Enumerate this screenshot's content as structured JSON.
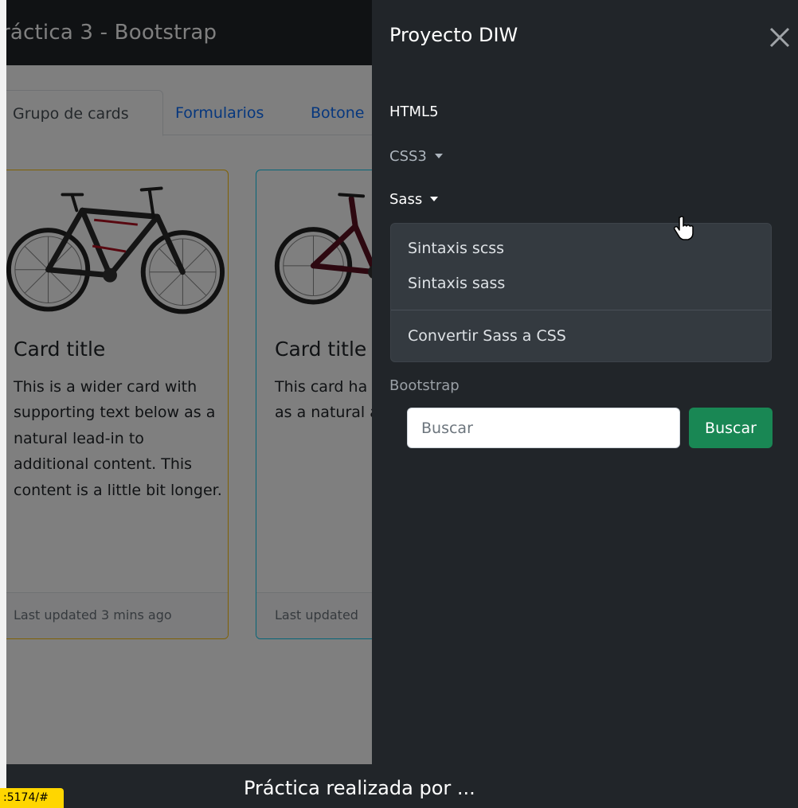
{
  "page": {
    "navbar_brand": "ráctica 3 - Bootstrap",
    "tabs": [
      {
        "label": "Grupo de cards",
        "active": true
      },
      {
        "label": "Formularios",
        "active": false
      },
      {
        "label": "Botone",
        "active": false
      }
    ],
    "cards": [
      {
        "title": "Card title",
        "text": "This is a wider card with supporting text below as a natural lead-in to additional content. This content is a little bit longer.",
        "footer": "Last updated 3 mins ago",
        "border_color": "#ffc107"
      },
      {
        "title": "Card title",
        "text": "This card ha supporting t as a natural additional c",
        "footer": "Last updated",
        "border_color": "#0dcaf0"
      }
    ],
    "footer_text": "Práctica realizada por ..."
  },
  "status_url": ":5174/#",
  "offcanvas": {
    "title": "Proyecto DIW",
    "close_icon": "close-icon",
    "nav": {
      "html5": "HTML5",
      "css3": "CSS3",
      "sass": "Sass",
      "bootstrap": "Bootstrap"
    },
    "sass_dropdown": {
      "items": [
        "Sintaxis scss",
        "Sintaxis sass"
      ],
      "after_divider": "Convertir Sass a CSS"
    },
    "search": {
      "placeholder": "Buscar",
      "button_label": "Buscar"
    }
  },
  "colors": {
    "dark": "#212529",
    "dropdown_bg": "#343a40",
    "link": "#0d6efd",
    "success": "#198754",
    "warning": "#ffc107",
    "info": "#0dcaf0"
  }
}
